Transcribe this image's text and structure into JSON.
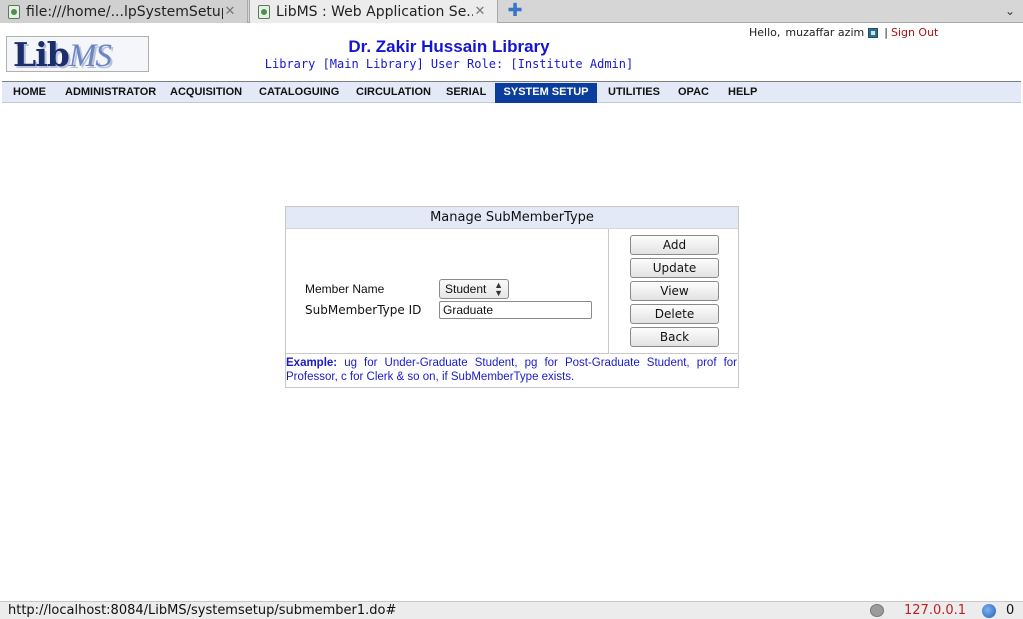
{
  "browser": {
    "tabs": [
      {
        "label": "file:///home/...lpSystemSetup",
        "close": "✕"
      },
      {
        "label": "LibMS : Web Application Se...",
        "close": "✕"
      }
    ],
    "new_tab": "✚",
    "tab_menu": "⌄"
  },
  "header": {
    "logo_lib": "Lib",
    "logo_ms": "MS",
    "library_name": "Dr. Zakir Hussain Library",
    "library_role": "Library [Main Library]  User Role: [Institute Admin]",
    "greeting": "Hello,",
    "username": "muzaffar azim",
    "separator": "|",
    "sign_out": "Sign Out"
  },
  "nav": {
    "items": [
      {
        "label": "HOME"
      },
      {
        "label": "ADMINISTRATOR"
      },
      {
        "label": "ACQUISITION"
      },
      {
        "label": "CATALOGUING"
      },
      {
        "label": "CIRCULATION"
      },
      {
        "label": "SERIAL"
      },
      {
        "label": "SYSTEM SETUP"
      },
      {
        "label": "UTILITIES"
      },
      {
        "label": "OPAC"
      },
      {
        "label": "HELP"
      }
    ],
    "active": "SYSTEM SETUP"
  },
  "form": {
    "title": "Manage SubMemberType",
    "member_name_label": "Member Name",
    "member_name_value": "Student",
    "submember_id_label": "SubMemberType ID",
    "submember_id_value": "Graduate",
    "buttons": {
      "add": "Add",
      "update": "Update",
      "view": "View",
      "delete": "Delete",
      "back": "Back"
    },
    "example_label": "Example:",
    "example_text": "ug for Under-Graduate Student, pg for Post-Graduate Student, prof for Professor, c for Clerk & so on, if SubMemberType exists."
  },
  "status": {
    "url": "http://localhost:8084/LibMS/systemsetup/submember1.do#",
    "ip": "127.0.0.1",
    "count": "0"
  },
  "colors": {
    "nav_active_bg": "#0b3d9c",
    "title_blue": "#1515d0",
    "sign_out_red": "#b01010",
    "panel_header_bg": "#e3e9f7"
  }
}
